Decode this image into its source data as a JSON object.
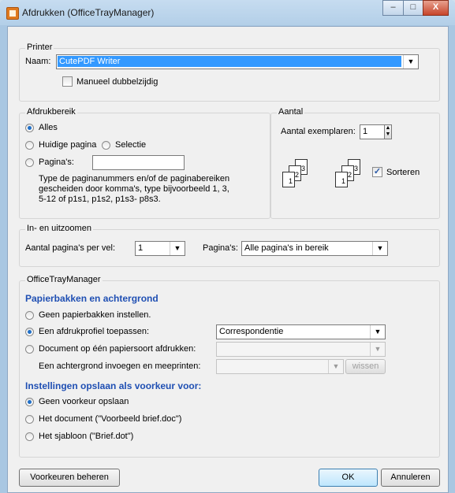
{
  "window": {
    "title": "Afdrukken (OfficeTrayManager)"
  },
  "printer": {
    "legend": "Printer",
    "name_label": "Naam:",
    "name_value": "CutePDF Writer",
    "duplex_label": "Manueel dubbelzijdig",
    "duplex_checked": false
  },
  "range": {
    "legend": "Afdrukbereik",
    "all": "Alles",
    "current": "Huidige pagina",
    "selection": "Selectie",
    "pages": "Pagina's:",
    "pages_value": "",
    "help": [
      "Type de paginanummers en/of de paginabereiken",
      "gescheiden door komma's, type bijvoorbeeld 1, 3,",
      "5-12 of p1s1, p1s2, p1s3- p8s3."
    ],
    "selected": "all"
  },
  "copies": {
    "legend": "Aantal",
    "label": "Aantal exemplaren:",
    "value": "1",
    "collate_label": "Sorteren",
    "collate_checked": true,
    "page_labels": [
      "1",
      "2",
      "3"
    ]
  },
  "zoom": {
    "legend": "In- en uitzoomen",
    "per_sheet_label": "Aantal pagina's per vel:",
    "per_sheet_value": "1",
    "pages_label": "Pagina's:",
    "pages_value": "Alle pagina's in bereik"
  },
  "otm": {
    "legend": "OfficeTrayManager",
    "section1": "Papierbakken en achtergrond",
    "opt_none": "Geen papierbakken instellen.",
    "opt_profile": "Een afdrukprofiel toepassen:",
    "profile_value": "Correspondentie",
    "opt_paper": "Document op één papiersoort afdrukken:",
    "background_label": "Een achtergrond invoegen en meeprinten:",
    "clear_button": "wissen",
    "section2": "Instellingen opslaan als voorkeur voor:",
    "pref_none": "Geen voorkeur opslaan",
    "pref_doc": "Het document (\"Voorbeeld brief.doc\")",
    "pref_tpl": "Het sjabloon (\"Brief.dot\")"
  },
  "buttons": {
    "manage": "Voorkeuren beheren",
    "ok": "OK",
    "cancel": "Annuleren"
  },
  "window_controls": {
    "minimize": "–",
    "maximize": "□",
    "close": "X"
  }
}
